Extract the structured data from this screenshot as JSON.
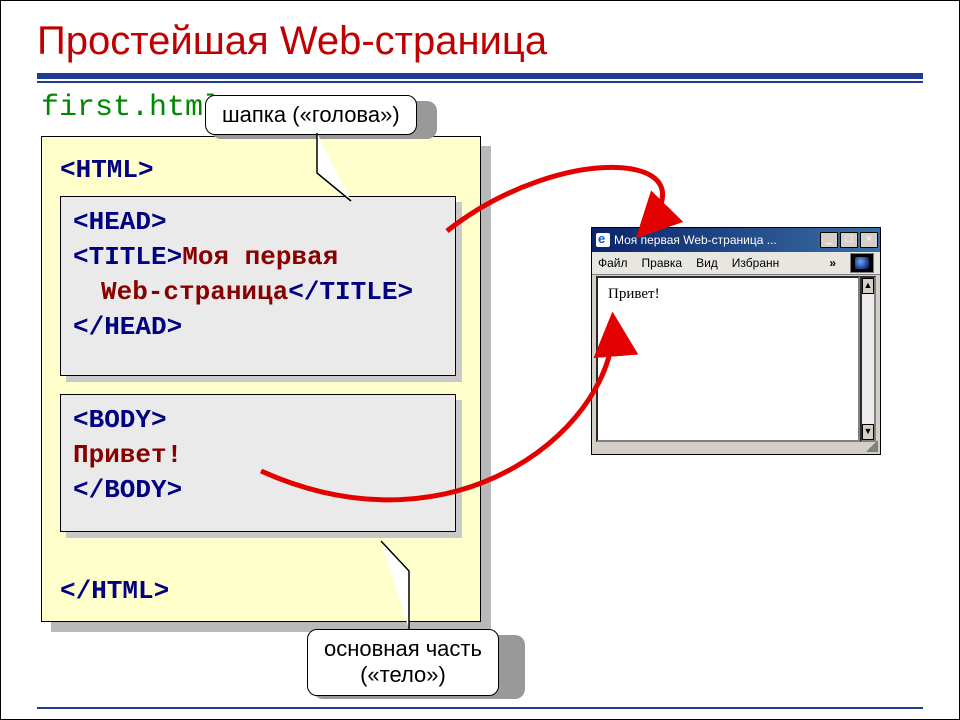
{
  "slide": {
    "title": "Простейшая Web-страница",
    "filename": "first.html"
  },
  "code": {
    "html_open": "<HTML>",
    "head_open": "<HEAD>",
    "title_open": "<TITLE>",
    "title_text_line1": "Моя первая",
    "title_text_line2": "Web-страница",
    "title_close": "</TITLE>",
    "head_close": "</HEAD>",
    "body_open": "<BODY>",
    "body_text": "Привет!",
    "body_close": "</BODY>",
    "html_close": "</HTML>"
  },
  "callouts": {
    "head_label": "шапка («голова»)",
    "body_label_line1": "основная часть",
    "body_label_line2": "(«тело»)"
  },
  "browser": {
    "window_title": "Моя первая Web-страница ...",
    "menu": {
      "file": "Файл",
      "edit": "Правка",
      "view": "Вид",
      "favorites": "Избранн",
      "more": "»"
    },
    "page_text": "Привет!",
    "btn_min": "_",
    "btn_max": "□",
    "btn_close": "×",
    "scroll_up": "▲",
    "scroll_down": "▼"
  }
}
